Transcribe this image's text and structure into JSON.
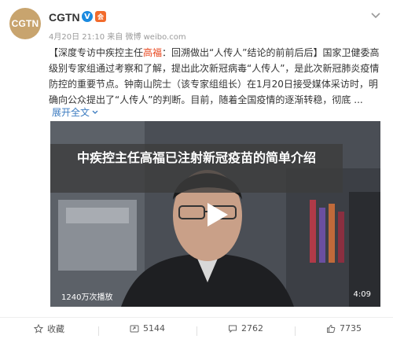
{
  "post": {
    "avatar_text": "CGTN",
    "user_name": "CGTN",
    "verified_badge": "V",
    "member_badge": "会",
    "meta": "4月20日 21:10 来自 微博 weibo.com",
    "text_part1": "【深度专访中疾控主任",
    "text_highlight": "高福",
    "text_part2": "：回溯做出“人传人”结论的前前后后】国家卫健委高级别专家组通过考察和了解，提出此次新冠病毒“人传人”，是此次新冠肺炎疫情防控的重要节点。钟南山院士（该专家组组长）在1月20日接受媒体采访时，明确向公众提出了“人传人”的判断。目前，随着全国疫情的逐渐转稳，彻底 ...",
    "expand_label": "展开全文"
  },
  "video": {
    "headline": "中疾控主任高福已注射新冠疫苗的简单介绍",
    "views": "1240万次播放",
    "duration": "4:09"
  },
  "footer": {
    "favorite": "收藏",
    "repost": "5144",
    "comment": "2762",
    "like": "7735"
  },
  "colors": {
    "highlight": "#e8451c",
    "link": "#3b7bc0",
    "verified": "#1a8ae0",
    "member": "#f26b2c"
  },
  "icons": [
    "chevron-down-icon",
    "verified-icon",
    "member-icon",
    "play-icon",
    "star-icon",
    "repost-icon",
    "comment-icon",
    "thumbs-up-icon"
  ]
}
